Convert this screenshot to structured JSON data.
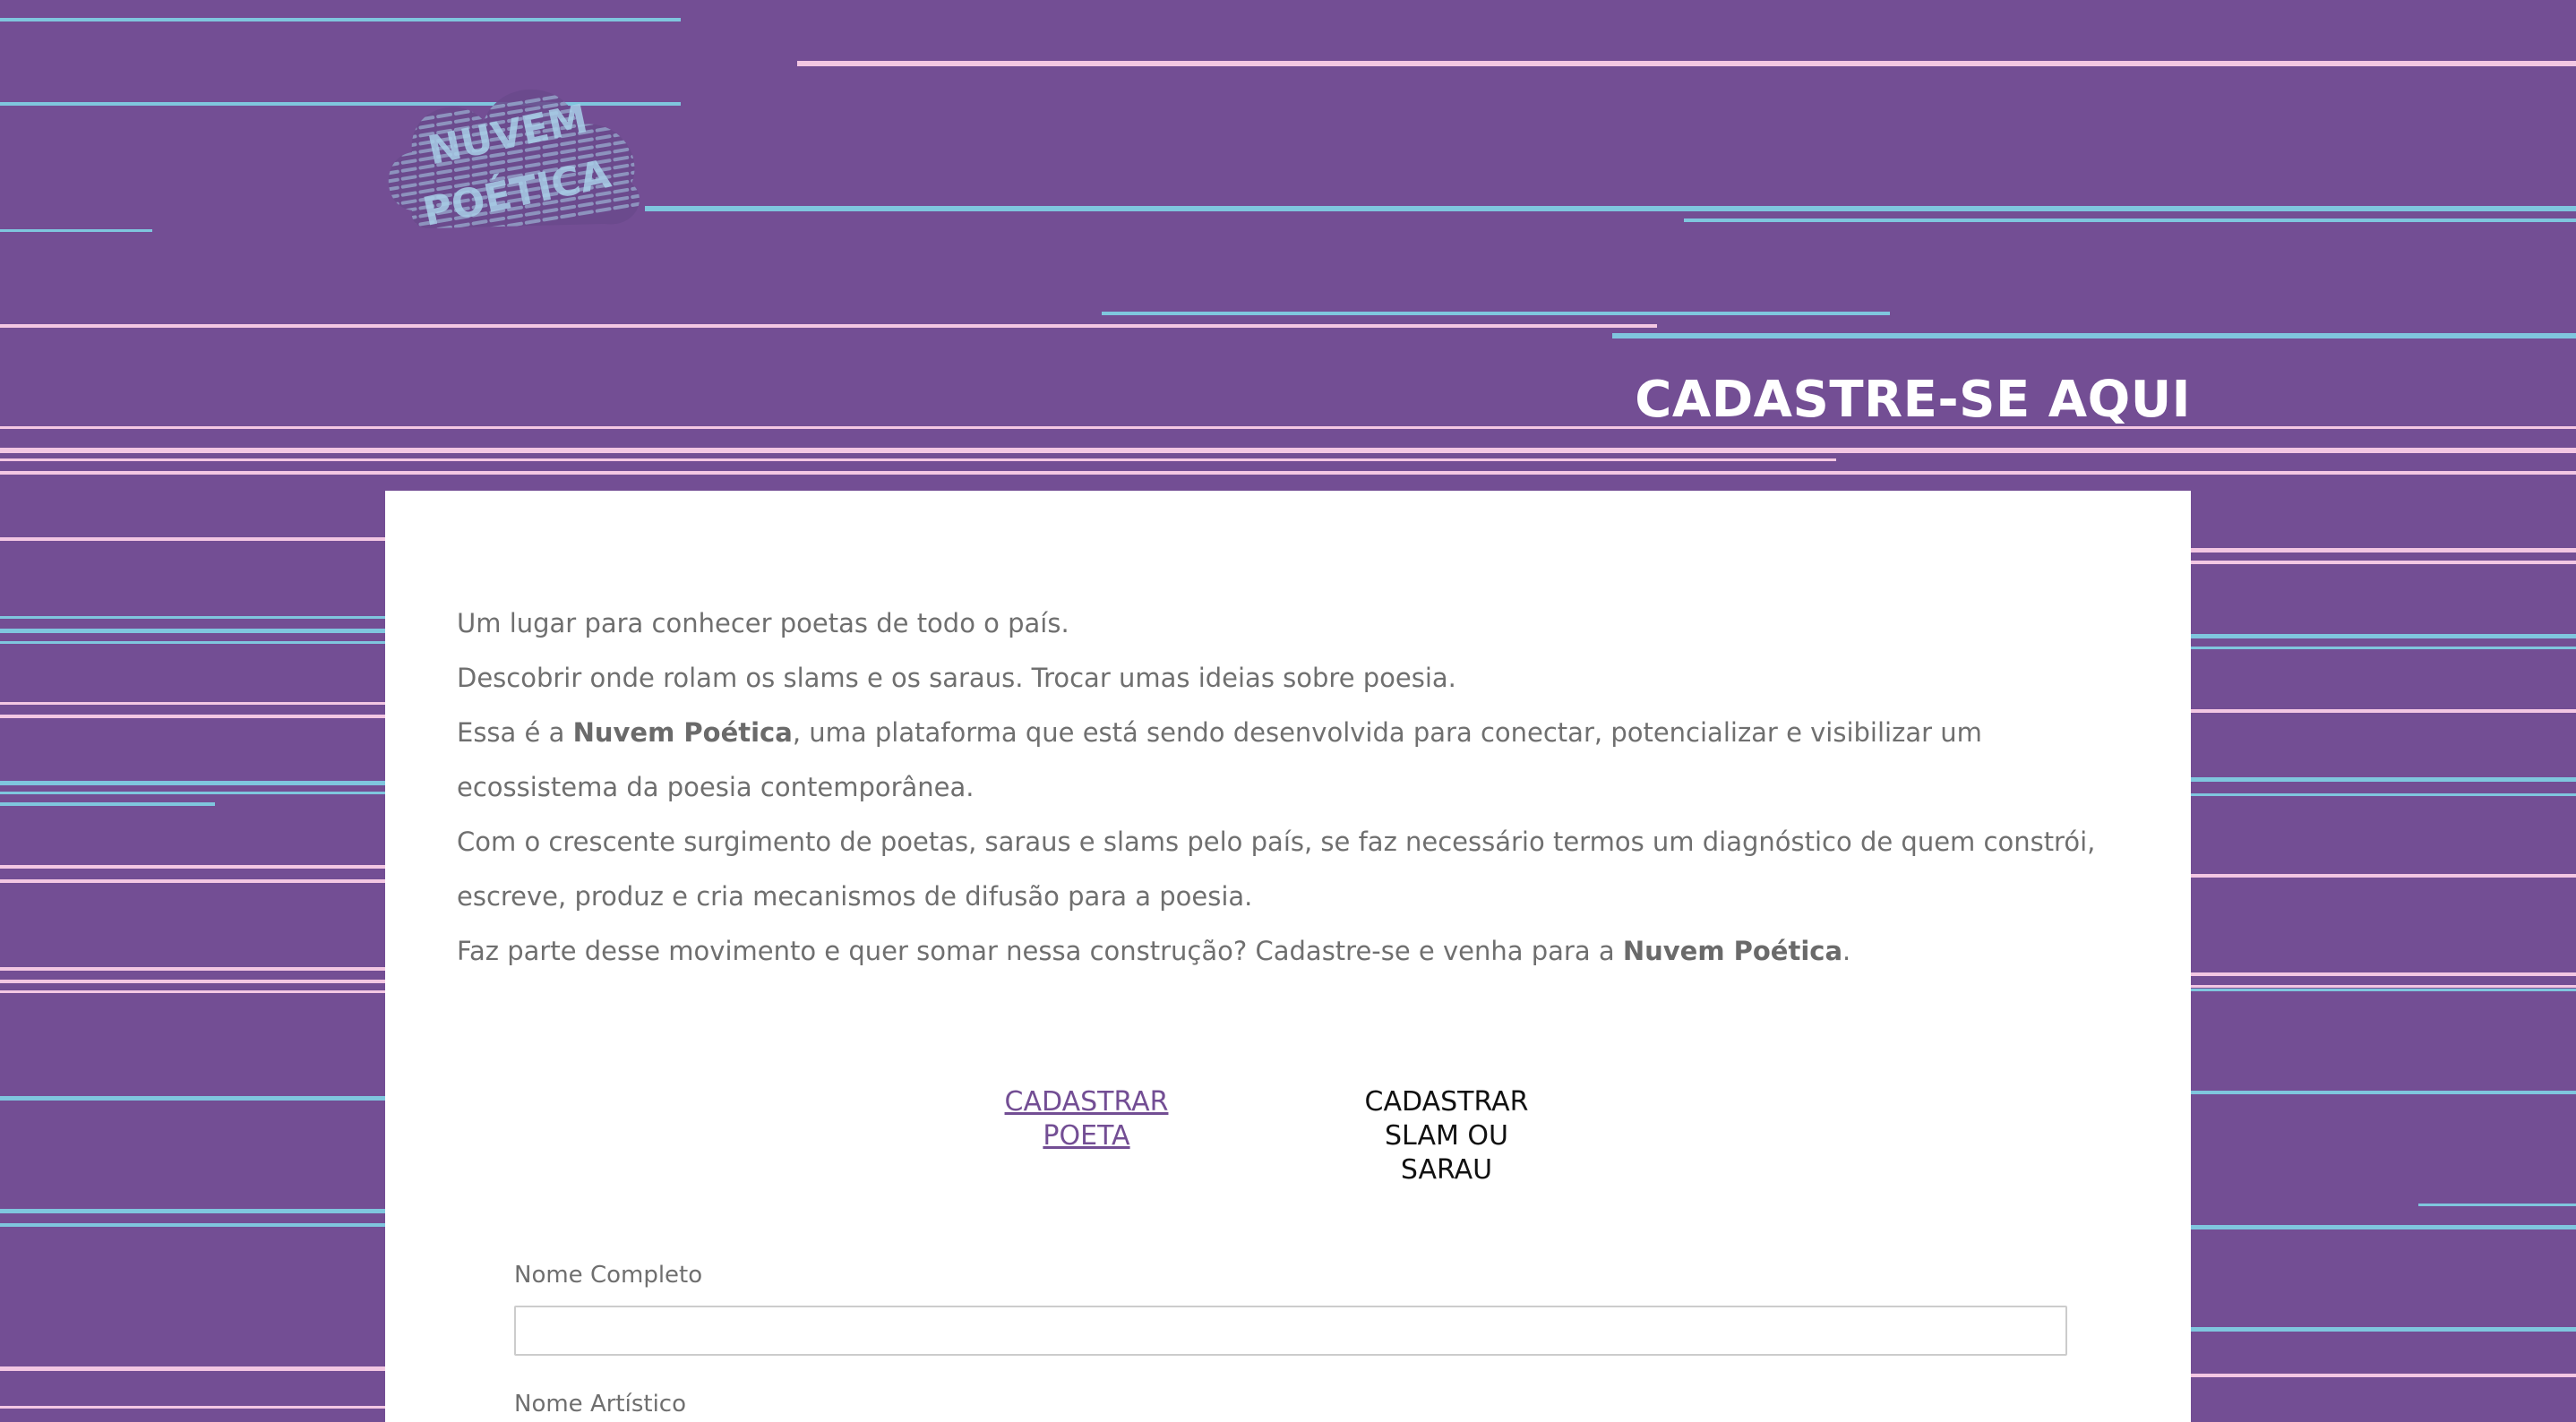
{
  "header": {
    "logo_text": "NUVEM POÉTICA",
    "title": "CADASTRE-SE AQUI"
  },
  "intro": {
    "line1": "Um lugar para conhecer poetas de todo o país.",
    "line2": "Descobrir onde rolam os slams e os saraus. Trocar umas ideias sobre poesia.",
    "line3_pre": "Essa é a ",
    "line3_bold": "Nuvem Poética",
    "line3_post": ", uma plataforma que está sendo desenvolvida para conectar, potencializar e visibilizar um ecossistema da poesia contemporânea.",
    "line4": "Com o crescente surgimento de poetas, saraus e slams pelo país, se faz necessário termos um diagnóstico de quem constrói, escreve, produz e cria mecanismos de difusão para a poesia.",
    "line5_pre": "Faz parte desse movimento e quer somar nessa construção? Cadastre-se e venha para a ",
    "line5_bold": "Nuvem Poética",
    "line5_post": "."
  },
  "tabs": {
    "poeta_line1": "CADASTRAR",
    "poeta_line2": "POETA",
    "slam_line1": "CADASTRAR",
    "slam_line2": "SLAM OU",
    "slam_line3": "SARAU"
  },
  "form": {
    "nome_completo_label": "Nome Completo",
    "nome_completo_value": "",
    "nome_artistico_label": "Nome Artístico"
  },
  "colors": {
    "background": "#734e94",
    "stripe_blue": "#7fc6de",
    "stripe_pink": "#f3c7e3",
    "link": "#734e94"
  }
}
